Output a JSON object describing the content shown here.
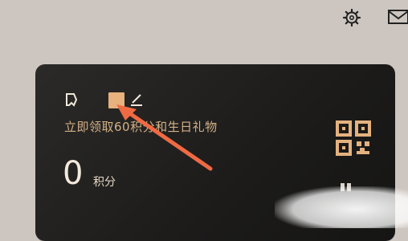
{
  "header": {
    "settings_icon": "gear-icon",
    "mail_icon": "mail-icon"
  },
  "card": {
    "promo_text": "立即领取60积分和生日礼物",
    "points_value": "0",
    "points_label": "积分",
    "badge_icon": "badge-icon",
    "edit_icon": "edit-icon",
    "qr_icon": "qr-code-icon"
  },
  "colors": {
    "background": "#cdc6c0",
    "card": "#1c1b1a",
    "accent": "#e7b27d",
    "arrow": "#ef6a43"
  }
}
